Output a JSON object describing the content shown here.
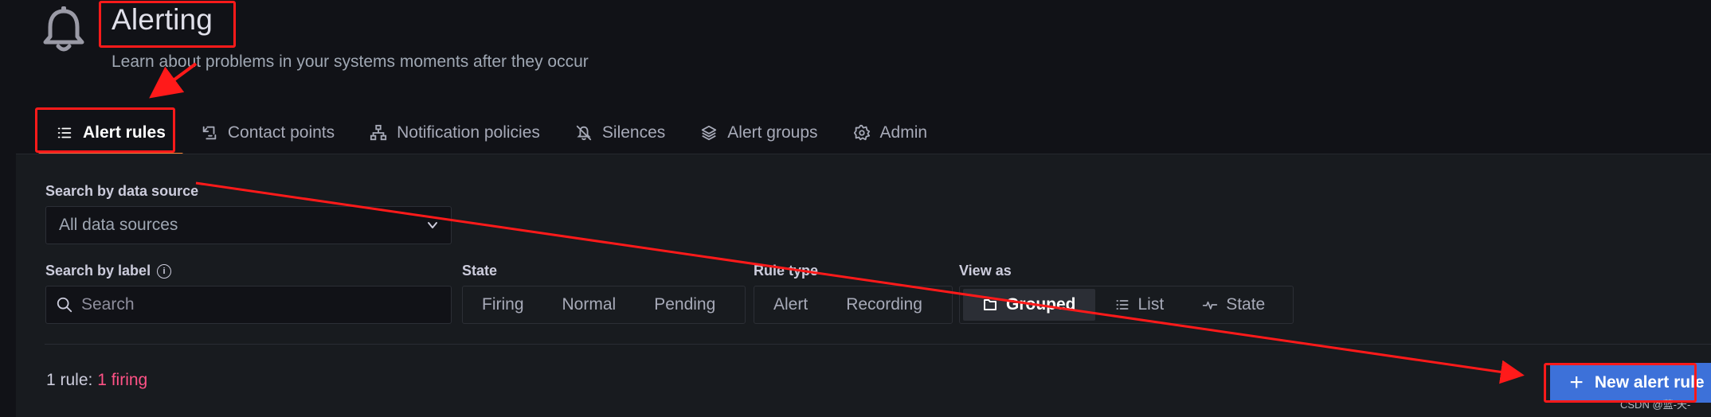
{
  "header": {
    "icon": "bell-icon",
    "title": "Alerting",
    "subtitle": "Learn about problems in your systems moments after they occur"
  },
  "tabs": [
    {
      "label": "Alert rules",
      "icon": "list-icon",
      "active": true
    },
    {
      "label": "Contact points",
      "icon": "contact-points-icon",
      "active": false
    },
    {
      "label": "Notification policies",
      "icon": "sitemap-icon",
      "active": false
    },
    {
      "label": "Silences",
      "icon": "bell-slash-icon",
      "active": false
    },
    {
      "label": "Alert groups",
      "icon": "layer-group-icon",
      "active": false
    },
    {
      "label": "Admin",
      "icon": "cog-icon",
      "active": false
    }
  ],
  "filters": {
    "datasource": {
      "label": "Search by data source",
      "value": "All data sources"
    },
    "label_search": {
      "label": "Search by label",
      "placeholder": "Search"
    },
    "state": {
      "label": "State",
      "options": [
        "Firing",
        "Normal",
        "Pending"
      ]
    },
    "rule_type": {
      "label": "Rule type",
      "options": [
        "Alert",
        "Recording"
      ]
    },
    "view_as": {
      "label": "View as",
      "options": [
        {
          "label": "Grouped",
          "icon": "folder-icon",
          "selected": true
        },
        {
          "label": "List",
          "icon": "list-icon",
          "selected": false
        },
        {
          "label": "State",
          "icon": "heartbeat-icon",
          "selected": false
        }
      ]
    }
  },
  "summary": {
    "prefix": "1 rule: ",
    "firing": "1 firing"
  },
  "new_rule_button": {
    "label": "New alert rule"
  },
  "watermark": "CSDN @蓝-天-",
  "colors": {
    "background": "#111217",
    "panel": "#181b1f",
    "primary": "#3d71d9",
    "firing": "#ff5286",
    "annotation": "#ff1a1a"
  }
}
